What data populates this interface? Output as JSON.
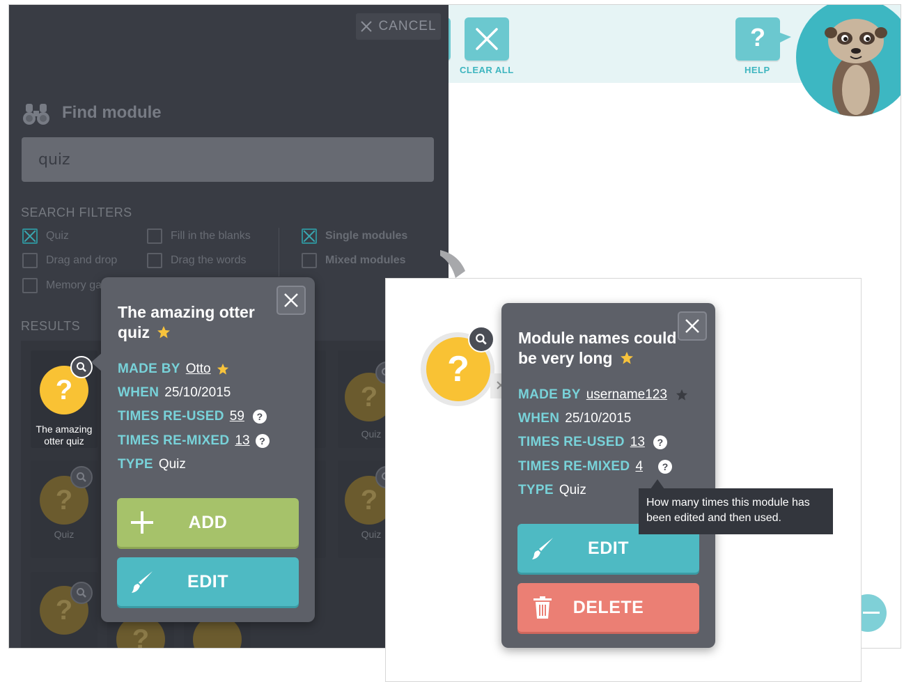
{
  "topbar": {
    "clear_all_label": "CLEAR ALL",
    "help_label": "HELP",
    "help_glyph": "?",
    "accent": "#6bc8cf"
  },
  "search_panel": {
    "cancel_label": "CANCEL",
    "title": "Find module",
    "search_value": "quiz",
    "filters_heading": "SEARCH FILTERS",
    "filters": [
      {
        "label": "Quiz",
        "checked": true
      },
      {
        "label": "Fill in the blanks",
        "checked": false
      },
      {
        "label": "Single modules",
        "checked": true
      },
      {
        "label": "Drag and drop",
        "checked": false
      },
      {
        "label": "Drag the words",
        "checked": false
      },
      {
        "label": "Mixed modules",
        "checked": false
      },
      {
        "label": "Memory ga",
        "checked": false
      }
    ],
    "results_heading": "RESULTS",
    "results": [
      {
        "label": "The amazing otter quiz",
        "icon": "?"
      },
      {
        "label": "Quiz",
        "icon": "?"
      },
      {
        "label": "Quiz",
        "icon": "?"
      },
      {
        "label": "Quiz",
        "icon": "?"
      },
      {
        "label": "",
        "icon": "?"
      },
      {
        "label": "",
        "icon": "?"
      }
    ]
  },
  "popup_left": {
    "title": "The amazing otter quiz",
    "made_by_key": "MADE BY",
    "made_by_value": "Otto",
    "when_key": "WHEN",
    "when_value": "25/10/2015",
    "reused_key": "TIMES RE-USED",
    "reused_value": "59",
    "remixed_key": "TIMES RE-MIXED",
    "remixed_value": "13",
    "type_key": "TYPE",
    "type_value": "Quiz",
    "add_label": "ADD",
    "edit_label": "EDIT",
    "help_glyph": "?"
  },
  "popup_right": {
    "title": "Module names could be very long",
    "made_by_key": "MADE BY",
    "made_by_value": "username123",
    "when_key": "WHEN",
    "when_value": "25/10/2015",
    "reused_key": "TIMES RE-USED",
    "reused_value": "13",
    "remixed_key": "TIMES RE-MIXED",
    "remixed_value": "4",
    "type_key": "TYPE",
    "type_value": "Quiz",
    "edit_label": "EDIT",
    "delete_label": "DELETE",
    "help_glyph": "?",
    "tooltip": "How many times this module has been edited and then used."
  },
  "colors": {
    "panel_dark": "#393c44",
    "popup_bg": "#5d6068",
    "key_teal": "#78d2d9",
    "add_green": "#a6c26a",
    "edit_teal": "#4ebac3",
    "delete_red": "#eb7f74",
    "star_yellow": "#f7c33c",
    "question_yellow": "#f9c234"
  }
}
